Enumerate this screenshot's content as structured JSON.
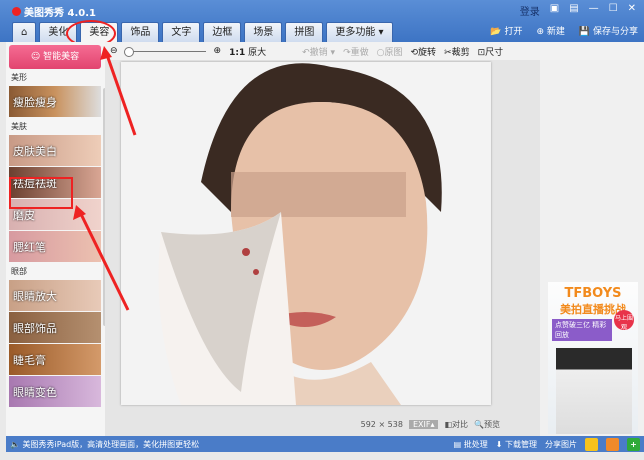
{
  "app": {
    "title": "美图秀秀 4.0.1",
    "login": "登录"
  },
  "tabs": [
    "美化",
    "美容",
    "饰品",
    "文字",
    "边框",
    "场景",
    "拼图",
    "更多功能 ▾"
  ],
  "top_actions": {
    "open": "打开",
    "new": "新建",
    "save_share": "保存与分享"
  },
  "toolbar": {
    "zoom_ratio": "1:1",
    "original_size": "原大",
    "undo": "撤销",
    "redo": "重做",
    "original": "原图",
    "rotate": "旋转",
    "crop": "裁剪",
    "resize": "尺寸"
  },
  "left": {
    "smart_button": "智能美容",
    "sections": [
      {
        "title": "美形",
        "items": [
          "瘦脸瘦身"
        ]
      },
      {
        "title": "美肤",
        "items": [
          "皮肤美白",
          "祛痘祛斑",
          "磨皮",
          "腮红笔"
        ]
      },
      {
        "title": "眼部",
        "items": [
          "眼睛放大",
          "眼部饰品",
          "睫毛膏",
          "眼睛变色"
        ]
      }
    ]
  },
  "canvas": {
    "dimensions": "592 × 538",
    "compare": "对比",
    "preview": "预览"
  },
  "ad": {
    "title": "TFBOYS",
    "subtitle": "美拍直播挑战",
    "tagline": "点赞破三亿 精彩回放",
    "badge": "马上围观"
  },
  "status": {
    "message": "美图秀秀iPad版，高清处理画面，美化拼图更轻松",
    "batch": "批处理",
    "download": "下载管理",
    "share": "分享图片"
  }
}
